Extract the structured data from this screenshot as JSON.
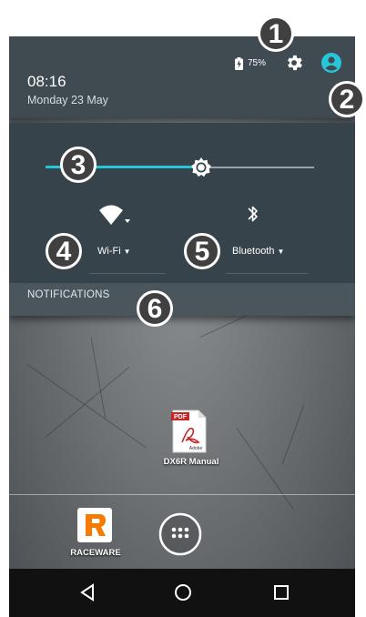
{
  "status": {
    "time": "08:16",
    "date": "Monday 23 May",
    "battery_percent": "75%"
  },
  "quick_settings": {
    "brightness_level": 0.58,
    "wifi_label": "Wi-Fi",
    "bluetooth_label": "Bluetooth",
    "notifications_label": "NOTIFICATIONS"
  },
  "callouts": [
    "1",
    "2",
    "3",
    "4",
    "5",
    "6"
  ],
  "desktop": {
    "pdf_badge": "PDF",
    "pdf_brand": "Adobe",
    "pdf_label": "DX6R Manual",
    "raceware_label": "RACEWARE"
  },
  "colors": {
    "accent": "#26c6da",
    "panel": "#37434a",
    "header": "#3f4a51"
  },
  "icons": [
    "battery-icon",
    "settings-gear-icon",
    "user-account-icon",
    "brightness-icon",
    "wifi-icon",
    "bluetooth-icon",
    "pdf-file-icon",
    "raceware-app-icon",
    "app-drawer-icon",
    "back-icon",
    "home-icon",
    "recents-icon"
  ]
}
